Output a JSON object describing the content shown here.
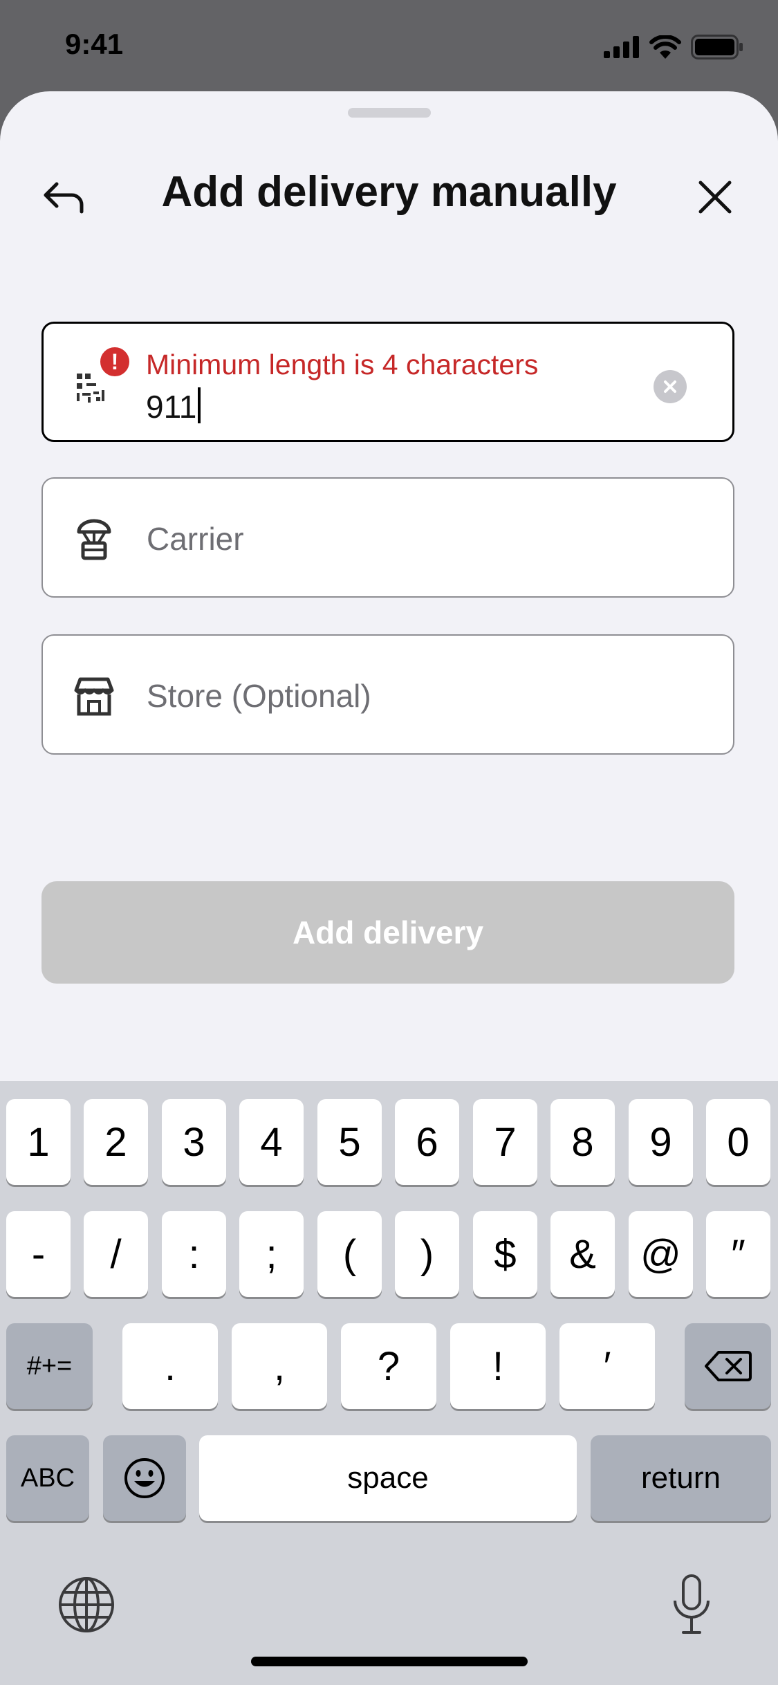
{
  "status_bar": {
    "time": "9:41"
  },
  "header": {
    "title": "Add delivery manually"
  },
  "form": {
    "tracking": {
      "error": "Minimum length is 4 characters",
      "value": "911"
    },
    "carrier": {
      "placeholder": "Carrier"
    },
    "store": {
      "placeholder": "Store (Optional)"
    },
    "submit_label": "Add delivery"
  },
  "keyboard": {
    "row1": [
      "1",
      "2",
      "3",
      "4",
      "5",
      "6",
      "7",
      "8",
      "9",
      "0"
    ],
    "row2": [
      "-",
      "/",
      ":",
      ";",
      "(",
      ")",
      "$",
      "&",
      "@",
      "″"
    ],
    "row3": [
      ".",
      ",",
      "?",
      "!",
      "′"
    ],
    "symbols_key": "#+=",
    "abc_key": "ABC",
    "space_key": "space",
    "return_key": "return"
  },
  "colors": {
    "error": "#c62828",
    "disabled_button": "#c7c7c7",
    "sheet_bg": "#f2f2f7"
  }
}
